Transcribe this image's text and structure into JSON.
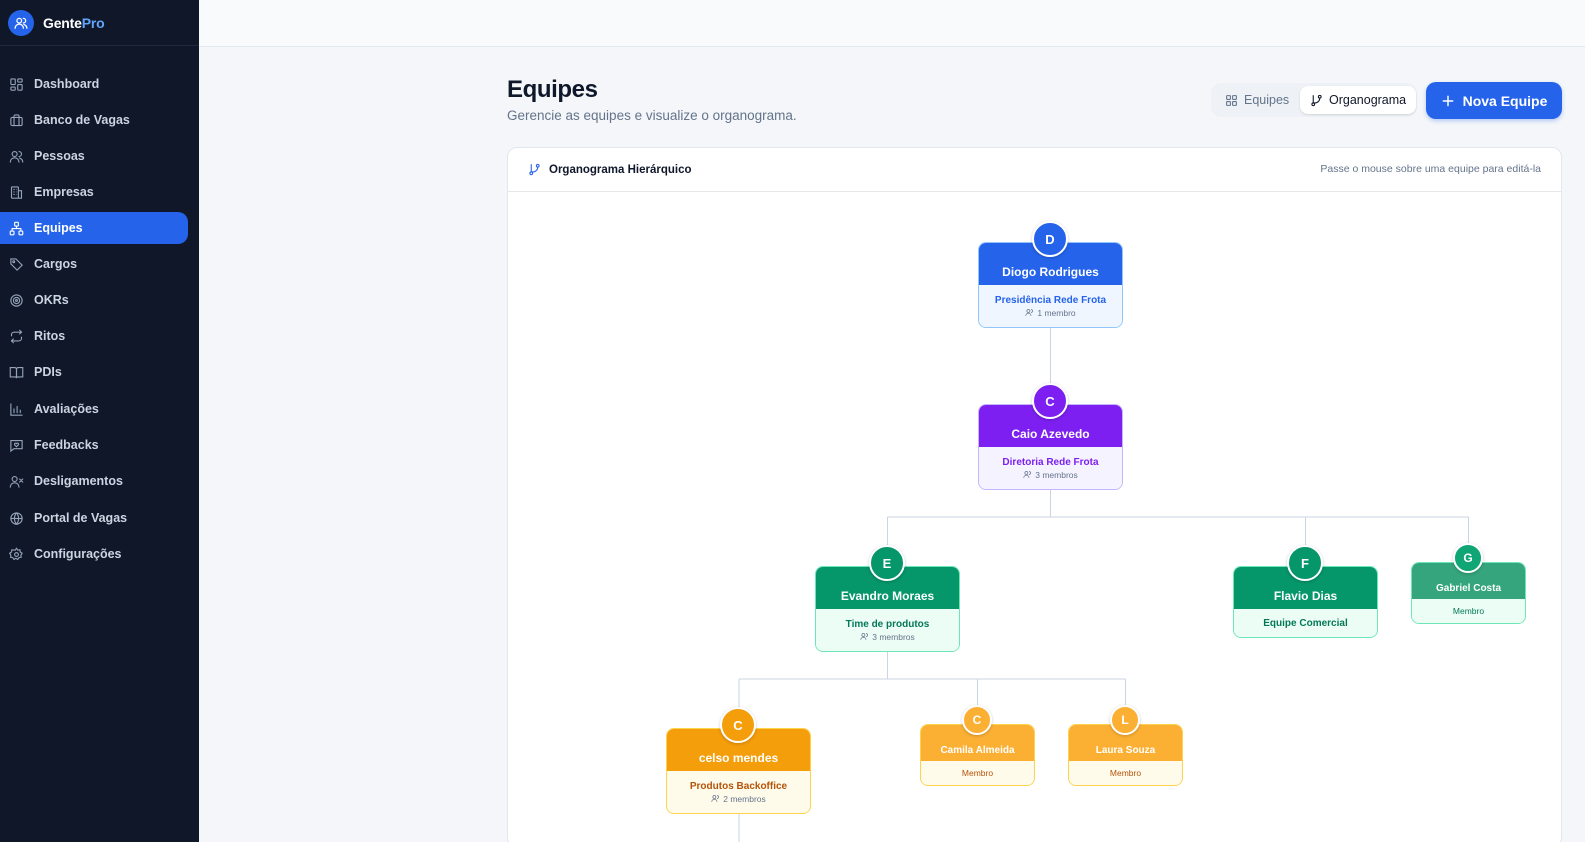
{
  "brand": {
    "name_part1": "Gente",
    "name_part2": "Pro"
  },
  "sidebar": {
    "items": [
      {
        "label": "Dashboard",
        "icon": "dashboard-icon"
      },
      {
        "label": "Banco de Vagas",
        "icon": "briefcase-icon"
      },
      {
        "label": "Pessoas",
        "icon": "users-icon"
      },
      {
        "label": "Empresas",
        "icon": "building-icon"
      },
      {
        "label": "Equipes",
        "icon": "network-icon",
        "active": true
      },
      {
        "label": "Cargos",
        "icon": "tag-icon"
      },
      {
        "label": "OKRs",
        "icon": "target-icon"
      },
      {
        "label": "Ritos",
        "icon": "repeat-icon"
      },
      {
        "label": "PDIs",
        "icon": "book-icon"
      },
      {
        "label": "Avaliações",
        "icon": "bar-chart-icon"
      },
      {
        "label": "Feedbacks",
        "icon": "message-heart-icon"
      },
      {
        "label": "Desligamentos",
        "icon": "user-x-icon"
      },
      {
        "label": "Portal de Vagas",
        "icon": "globe-icon"
      },
      {
        "label": "Configurações",
        "icon": "gear-icon"
      }
    ]
  },
  "header": {
    "title": "Equipes",
    "subtitle": "Gerencie as equipes e visualize o organograma.",
    "view_equipes": "Equipes",
    "view_organograma": "Organograma",
    "new_button": "Nova Equipe"
  },
  "card": {
    "title": "Organograma Hierárquico",
    "hint": "Passe o mouse sobre uma equipe para editá-la"
  },
  "org": {
    "nodes": [
      {
        "initial": "D",
        "leader": "Diogo Rodrigues",
        "team": "Presidência Rede Frota",
        "members": "1 membro"
      },
      {
        "initial": "C",
        "leader": "Caio Azevedo",
        "team": "Diretoria Rede Frota",
        "members": "3 membros"
      },
      {
        "initial": "E",
        "leader": "Evandro Moraes",
        "team": "Time de produtos",
        "members": "3 membros"
      },
      {
        "initial": "F",
        "leader": "Flavio Dias",
        "team": "Equipe Comercial"
      },
      {
        "initial": "G",
        "leader": "Gabriel Costa",
        "team": "Membro"
      },
      {
        "initial": "C",
        "leader": "celso mendes",
        "team": "Produtos Backoffice",
        "members": "2 membros"
      },
      {
        "initial": "C",
        "leader": "Camila Almeida",
        "team": "Membro"
      },
      {
        "initial": "L",
        "leader": "Laura Souza",
        "team": "Membro"
      }
    ]
  }
}
